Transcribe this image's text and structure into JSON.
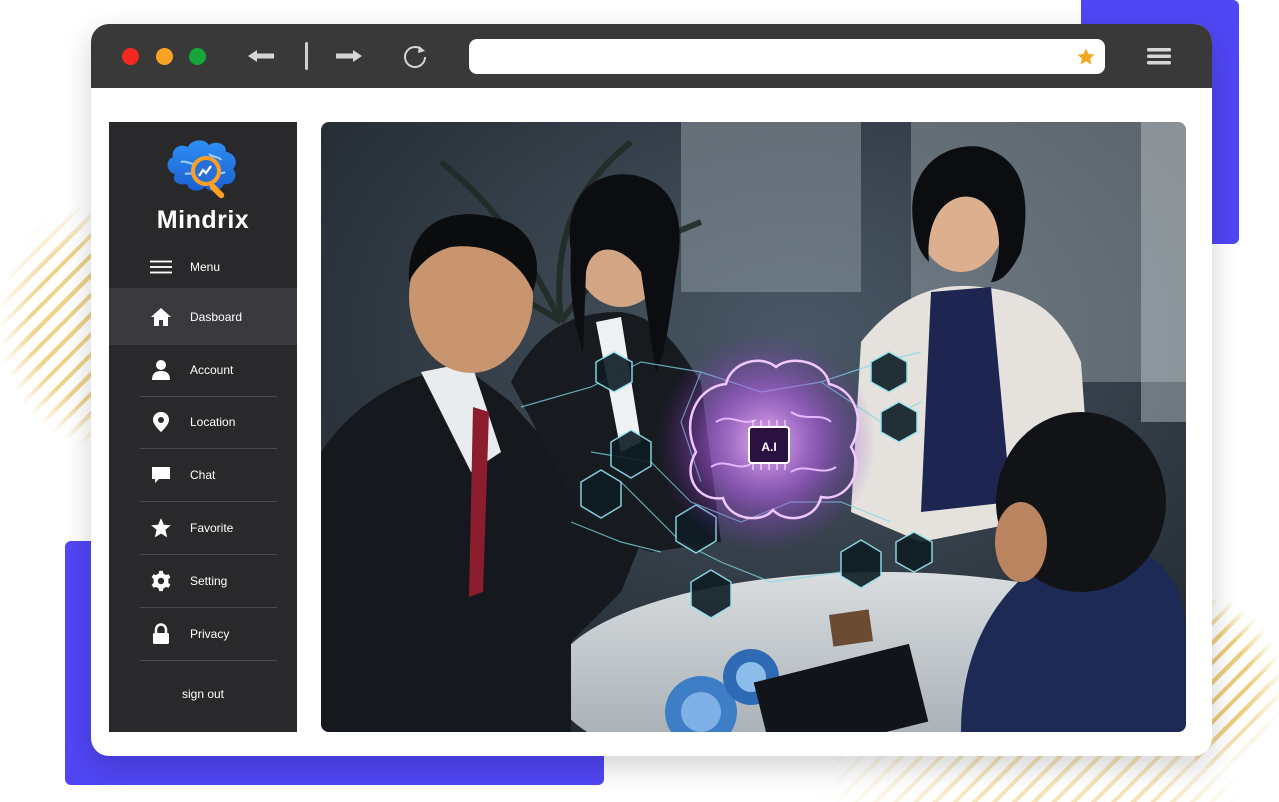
{
  "browser": {
    "url": "",
    "controls": [
      "back-icon",
      "forward-icon",
      "reload-icon",
      "star-icon",
      "menu-icon"
    ]
  },
  "brand": {
    "name": "Mindrix",
    "logo": "brain-search-logo"
  },
  "sidebar": {
    "menu_label": "Menu",
    "items": [
      {
        "label": "Dasboard",
        "icon": "home-icon",
        "active": true
      },
      {
        "label": "Account",
        "icon": "user-icon"
      },
      {
        "label": "Location",
        "icon": "location-pin-icon"
      },
      {
        "label": "Chat",
        "icon": "chat-icon"
      },
      {
        "label": "Favorite",
        "icon": "star-icon"
      },
      {
        "label": "Setting",
        "icon": "gear-icon"
      },
      {
        "label": "Privacy",
        "icon": "lock-icon"
      }
    ],
    "signout_label": "sign out"
  },
  "hero": {
    "chip_label": "A.I"
  },
  "colors": {
    "accent": "#5046f5",
    "sidebar_bg": "#29292b",
    "titlebar_bg": "#393939",
    "star": "#f5a623",
    "hologram": "#c56cf0"
  }
}
